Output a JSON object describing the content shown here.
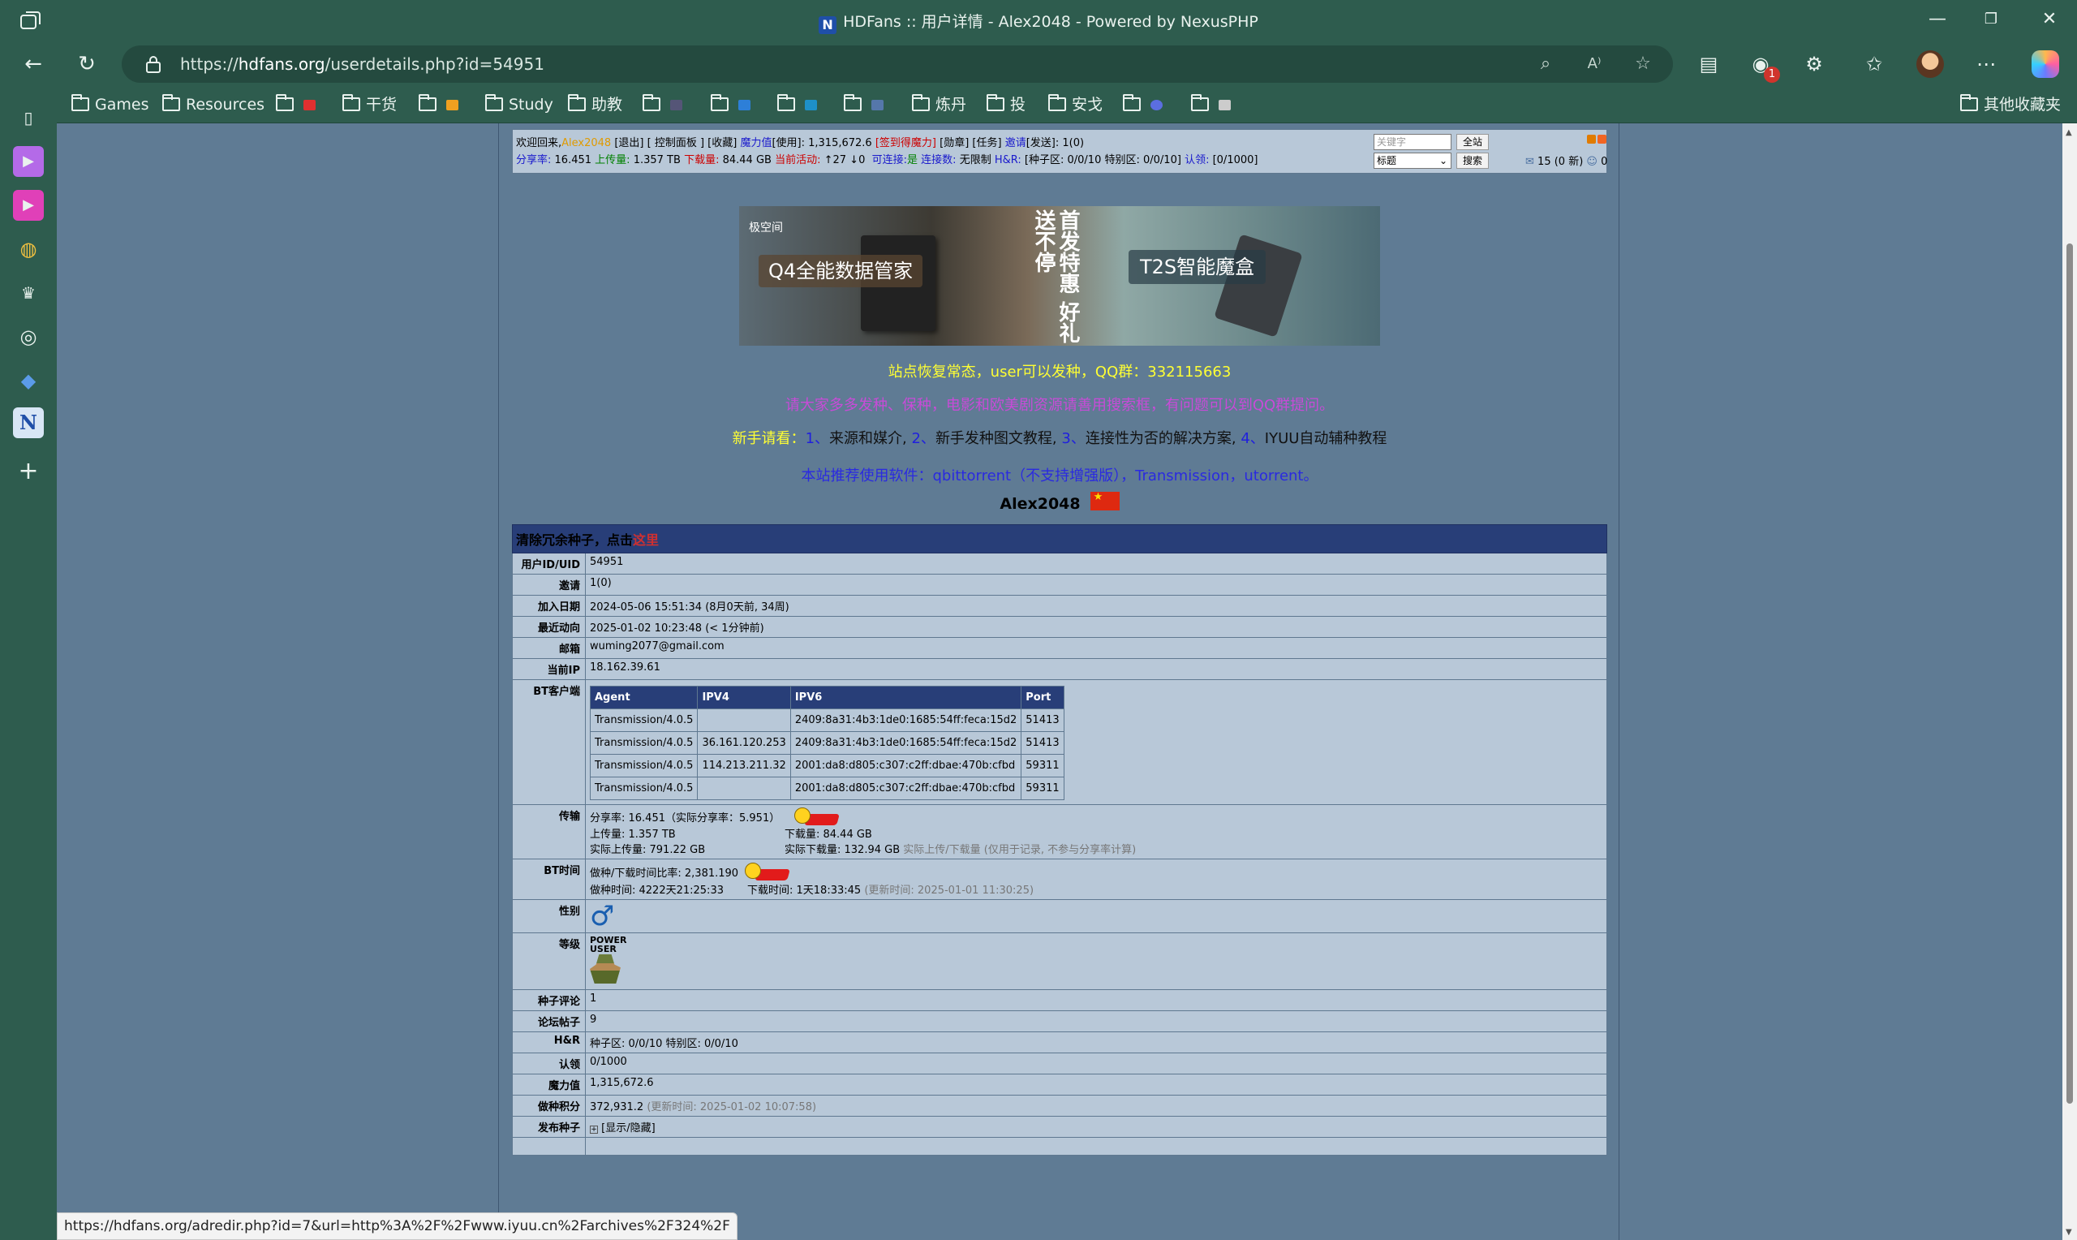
{
  "window": {
    "title": "HDFans :: 用户详情 - Alex2048 - Powered by NexusPHP",
    "favicon_letter": "N"
  },
  "address_bar": {
    "url_prefix": "https://",
    "url_domain": "hdfans.org",
    "url_path": "/userdetails.php?id=54951"
  },
  "extension_badge": "1",
  "bookmarks": [
    {
      "label": "Games",
      "icon_color": ""
    },
    {
      "label": "Resources",
      "icon_color": ""
    },
    {
      "label": "",
      "icon_color": "#e03030"
    },
    {
      "label": "干货",
      "icon_color": ""
    },
    {
      "label": "",
      "icon_color": "#f0a020"
    },
    {
      "label": "Study",
      "icon_color": ""
    },
    {
      "label": "助教",
      "icon_color": ""
    },
    {
      "label": "",
      "icon_color": "#555577"
    },
    {
      "label": "",
      "icon_color": "#2d7fd8"
    },
    {
      "label": "",
      "icon_color": "#1e90c8"
    },
    {
      "label": "",
      "icon_color": "#5577aa"
    },
    {
      "label": "炼丹",
      "icon_color": ""
    },
    {
      "label": "投",
      "icon_color": ""
    },
    {
      "label": "安戈",
      "icon_color": ""
    },
    {
      "label": "",
      "icon_color": "#5b6ee0"
    },
    {
      "label": "",
      "icon_color": "#cccccc"
    }
  ],
  "bookmarks_other": "其他收藏夹",
  "infobar": {
    "welcome": "欢迎回来,",
    "username": "Alex2048",
    "links_line1": "[退出] [ 控制面板 ] [收藏]",
    "bonus_label": "魔力值",
    "bonus_text": "[使用]: 1,315,672.6",
    "signin_text": "[签到得魔力]",
    "medal_task": "[勋章] [任务]",
    "invite_label": "邀请",
    "invite_text": "[发送]: 1(0)",
    "ratio_label": "分享率:",
    "ratio_value": "16.451",
    "uploaded_label": "上传量:",
    "uploaded_value": "1.357 TB",
    "downloaded_label": "下载量:",
    "downloaded_value": "84.44 GB",
    "active_label": "当前活动:",
    "active_value": "↑27 ↓0",
    "connectable_label": "可连接:",
    "connectable_value": "是",
    "connlimit_label": "连接数:",
    "connlimit_value": "无限制",
    "hnr_label": "H&R:",
    "hnr_value": "[种子区: 0/0/10 特别区: 0/0/10]",
    "claim_label": "认领:",
    "claim_value": "[0/1000]",
    "search_placeholder": "关键字",
    "search_select": "标题",
    "btn_all": "全站",
    "btn_search": "搜索",
    "messages": "15 (0 新)",
    "friends": "0"
  },
  "banner": {
    "logo": "极空间",
    "q4": "Q4全能数据管家",
    "slogan": "首发特惠 好礼送不停",
    "t2s": "T2S智能魔盒"
  },
  "notices": {
    "n1": "站点恢复常态，user可以发种，QQ群：332115663",
    "n2": "请大家多多发种、保种，电影和欧美剧资源请善用搜索框，有问题可以到QQ群提问。",
    "n3_prefix": "新手请看：",
    "n3_i1": "1、",
    "n3_t1": "来源和媒介,",
    "n3_i2": " 2、",
    "n3_t2": "新手发种图文教程,",
    "n3_i3": " 3、",
    "n3_t3": "连接性为否的解决方案,",
    "n3_i4": "  4、",
    "n3_t4": "IYUU自动辅种教程",
    "n4": "本站推荐使用软件：qbittorrent（不支持增强版），Transmission，utorrent。"
  },
  "profile_name": "Alex2048",
  "caption": {
    "text": "清除冗余种子，点击",
    "link": "这里"
  },
  "rows": {
    "uid_label": "用户ID/UID",
    "uid": "54951",
    "invite_label": "邀请",
    "invite": "1(0)",
    "join_label": "加入日期",
    "join": "2024-05-06 15:51:34 (8月0天前, 34周)",
    "last_label": "最近动向",
    "last": "2025-01-02 10:23:48 (< 1分钟前)",
    "email_label": "邮箱",
    "email": "wuming2077@gmail.com",
    "ip_label": "当前IP",
    "ip": "18.162.39.61",
    "bt_label": "BT客户端",
    "transfer_label": "传输",
    "ratio_text": "分享率: 16.451（实际分享率：5.951）",
    "up_text": "上传量: 1.357 TB",
    "down_text": "下载量: 84.44 GB",
    "real_up_text": "实际上传量: 791.22 GB",
    "real_down_text": "实际下载量: 132.94 GB",
    "real_note": "实际上传/下载量 (仅用于记录, 不参与分享率计算)",
    "bttime_label": "BT时间",
    "seedratio_text": "做种/下载时间比率: 2,381.190",
    "seedtime_text": "做种时间: 4222天21:25:33",
    "leechtime_text": "下载时间: 1天18:33:45",
    "bttime_note": "(更新时间: 2025-01-01 11:30:25)",
    "gender_label": "性别",
    "gender_symbol": "♂",
    "class_label": "等级",
    "class_text": "POWER USER",
    "comments_label": "种子评论",
    "comments": "1",
    "posts_label": "论坛帖子",
    "posts": "9",
    "hnr_label": "H&R",
    "hnr": "种子区: 0/0/10 特别区: 0/0/10",
    "claim_label": "认领",
    "claim": "0/1000",
    "bonus_label": "魔力值",
    "bonus": "1,315,672.6",
    "seedpts_label": "做种积分",
    "seedpts": "372,931.2",
    "seedpts_note": "(更新时间: 2025-01-02 10:07:58)",
    "published_label": "发布种子",
    "published_toggle": "[显示/隐藏]"
  },
  "clients": {
    "headers": [
      "Agent",
      "IPV4",
      "IPV6",
      "Port"
    ],
    "rows": [
      [
        "Transmission/4.0.5",
        "",
        "2409:8a31:4b3:1de0:1685:54ff:feca:15d2",
        "51413"
      ],
      [
        "Transmission/4.0.5",
        "36.161.120.253",
        "2409:8a31:4b3:1de0:1685:54ff:feca:15d2",
        "51413"
      ],
      [
        "Transmission/4.0.5",
        "114.213.211.32",
        "2001:da8:d805:c307:c2ff:dbae:470b:cfbd",
        "59311"
      ],
      [
        "Transmission/4.0.5",
        "",
        "2001:da8:d805:c307:c2ff:dbae:470b:cfbd",
        "59311"
      ]
    ]
  },
  "status_url": "https://hdfans.org/adredir.php?id=7&url=http%3A%2F%2Fwww.iyuu.cn%2Farchives%2F324%2F"
}
